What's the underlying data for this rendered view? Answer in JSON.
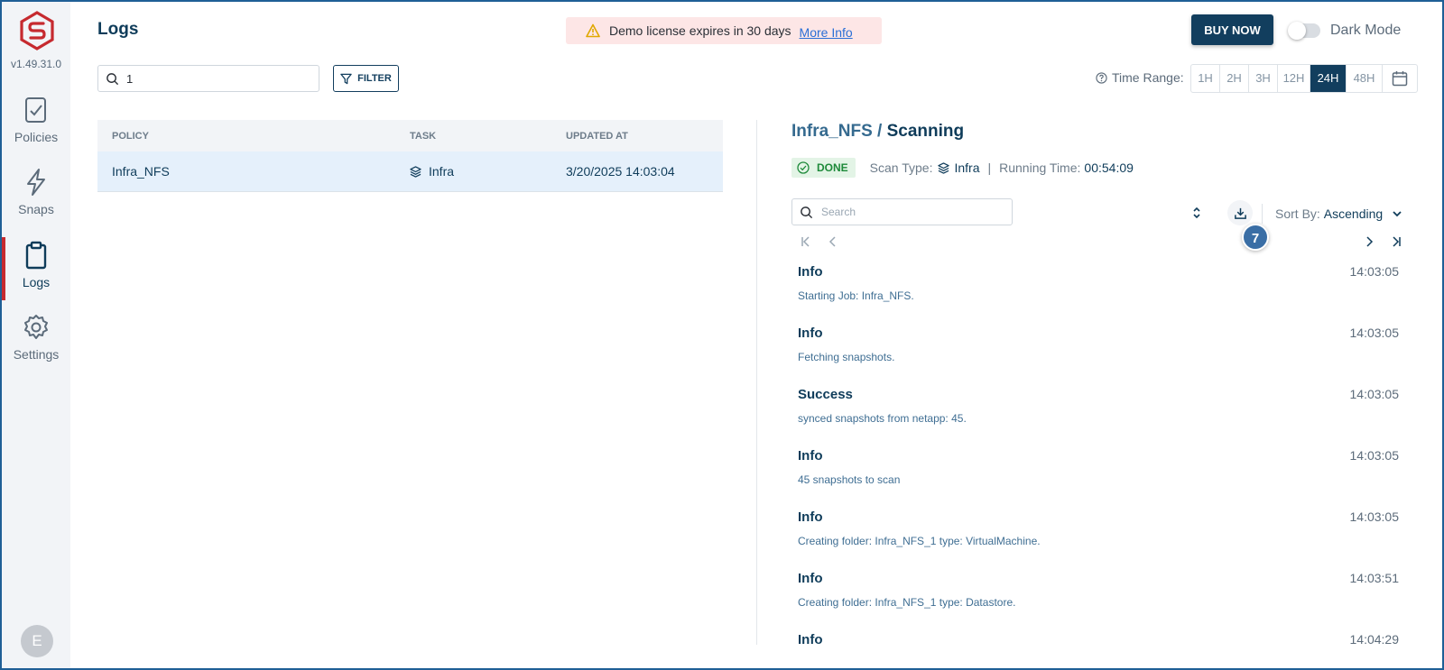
{
  "app": {
    "version": "v1.49.31.0",
    "page_title": "Logs",
    "user_initial": "E"
  },
  "sidebar": {
    "items": [
      {
        "label": "Policies",
        "icon": "policies-icon"
      },
      {
        "label": "Snaps",
        "icon": "snaps-icon"
      },
      {
        "label": "Logs",
        "icon": "logs-icon",
        "active": true
      },
      {
        "label": "Settings",
        "icon": "gear-icon"
      }
    ]
  },
  "header": {
    "license_text": "Demo license expires in 30 days",
    "license_link": "More Info",
    "buy_label": "BUY NOW",
    "dark_mode_label": "Dark Mode",
    "dark_mode_on": false
  },
  "toolbar": {
    "search_value": "1",
    "filter_label": "FILTER",
    "time_range_label": "Time Range:",
    "time_ranges": [
      "1H",
      "2H",
      "3H",
      "12H",
      "24H",
      "48H"
    ],
    "time_range_selected": "24H"
  },
  "table": {
    "headers": [
      "POLICY",
      "TASK",
      "UPDATED AT"
    ],
    "rows": [
      {
        "policy": "Infra_NFS",
        "task": "Infra",
        "updated_at": "3/20/2025 14:03:04"
      }
    ]
  },
  "detail": {
    "policy": "Infra_NFS",
    "separator": "/",
    "task": "Scanning",
    "status": "DONE",
    "scan_type_label": "Scan Type:",
    "scan_type": "Infra",
    "divider": "|",
    "running_time_label": "Running Time:",
    "running_time": "00:54:09",
    "search_placeholder": "Search",
    "sort_by_label": "Sort By:",
    "sort_by_value": "Ascending",
    "count": "7"
  },
  "logs": [
    {
      "level": "Info",
      "time": "14:03:05",
      "message": "Starting Job: Infra_NFS."
    },
    {
      "level": "Info",
      "time": "14:03:05",
      "message": "Fetching snapshots."
    },
    {
      "level": "Success",
      "time": "14:03:05",
      "message": "synced snapshots from netapp: 45."
    },
    {
      "level": "Info",
      "time": "14:03:05",
      "message": "45 snapshots to scan"
    },
    {
      "level": "Info",
      "time": "14:03:05",
      "message": "Creating folder: Infra_NFS_1 type: VirtualMachine."
    },
    {
      "level": "Info",
      "time": "14:03:51",
      "message": "Creating folder: Infra_NFS_1 type: Datastore."
    },
    {
      "level": "Info",
      "time": "14:04:29",
      "message": ""
    }
  ],
  "colors": {
    "brand_red": "#c62a2f",
    "primary_navy": "#123e5e",
    "selected_row": "#e5f0fb",
    "done_green": "#1e8a3a"
  }
}
